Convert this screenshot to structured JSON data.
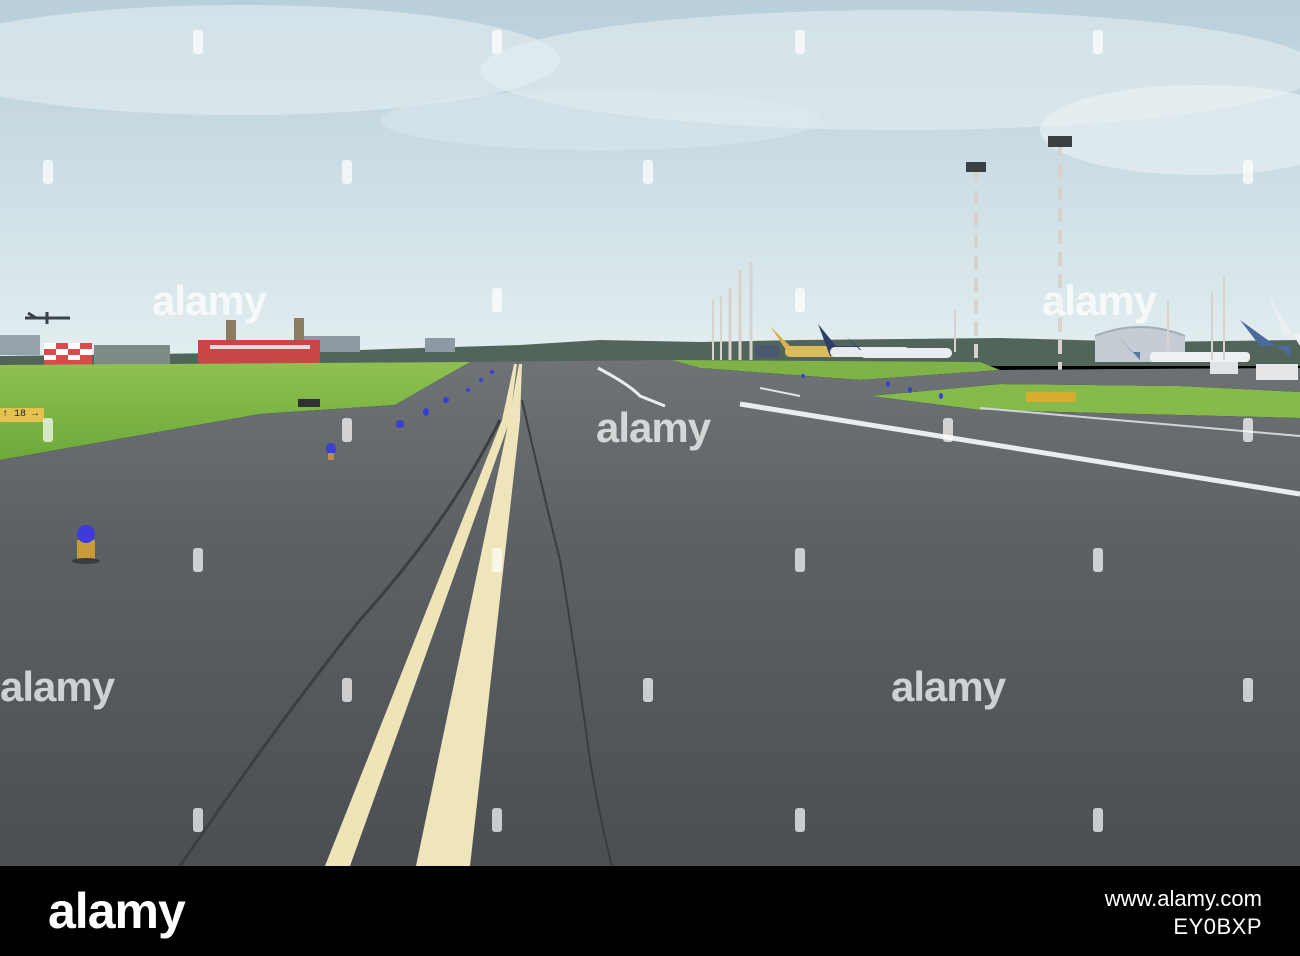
{
  "photo": {
    "subject": "airport taxiway with double yellow center line and blue edge lights",
    "sign_text": "↑ 18 →"
  },
  "watermark": {
    "text": "alamy"
  },
  "footer": {
    "brand": "alamy",
    "domain": "www.alamy.com",
    "image_code": "EY0BXP"
  }
}
